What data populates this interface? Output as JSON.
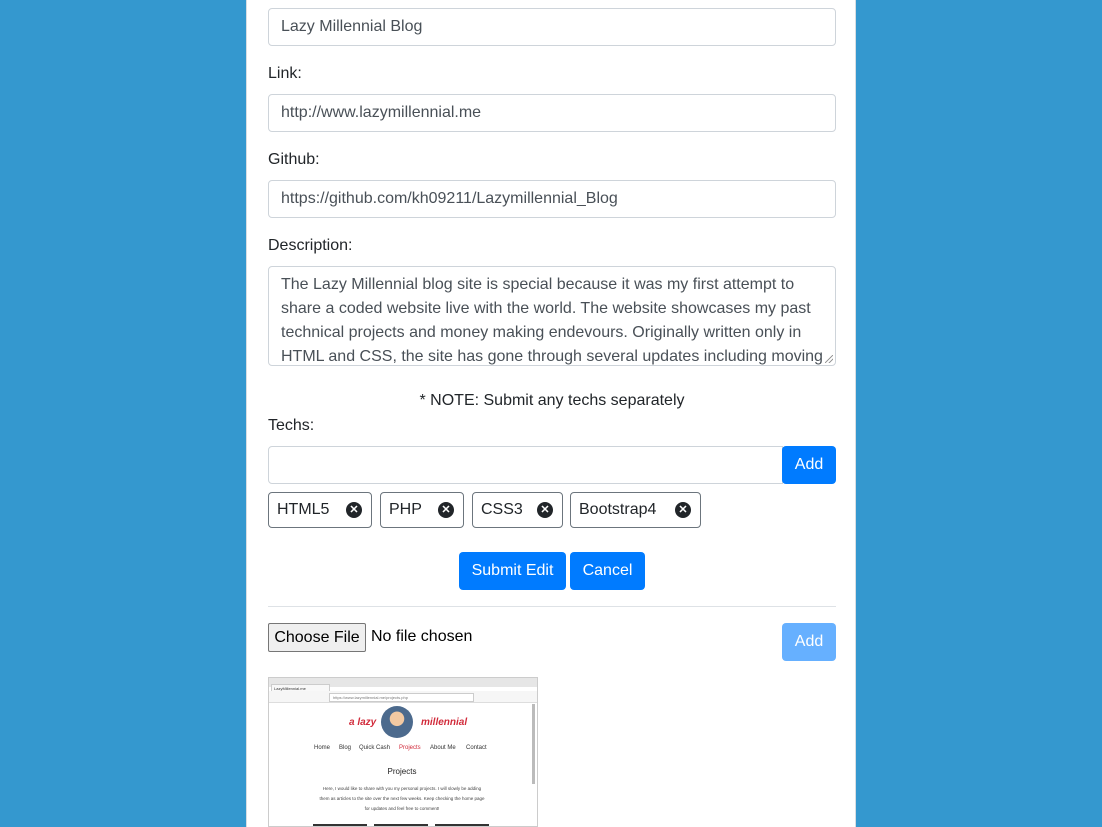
{
  "form": {
    "title_value": "Lazy Millennial Blog",
    "link_label": "Link:",
    "link_value": "http://www.lazymillennial.me",
    "github_label": "Github:",
    "github_value": "https://github.com/kh09211/Lazymillennial_Blog",
    "description_label": "Description:",
    "description_value": "The Lazy Millennial blog site is special because it was my first attempt to share a coded website live with the world. The website showcases my past technical projects and money making endevours. Originally written only in HTML and CSS, the site has gone through several updates including moving",
    "note": "* NOTE: Submit any techs separately",
    "techs_label": "Techs:",
    "techs_input_value": "",
    "add_tech_label": "Add",
    "techs": [
      {
        "label": "HTML5"
      },
      {
        "label": "PHP"
      },
      {
        "label": "CSS3"
      },
      {
        "label": "Bootstrap4"
      }
    ],
    "remove_glyph": "✕",
    "submit_label": "Submit Edit",
    "cancel_label": "Cancel"
  },
  "upload": {
    "choose_file_label": "Choose File",
    "file_status": "No file chosen",
    "add_label": "Add"
  },
  "thumbnail": {
    "tab_title": "LazyMillennial.me",
    "url": "https://www.lazymillennial.me/projects.php",
    "brand_left": "a lazy",
    "brand_right": "millennial",
    "nav": [
      "Home",
      "Blog",
      "Quick Cash",
      "Projects",
      "About Me",
      "Contact"
    ],
    "active_nav": "Projects",
    "heading": "Projects",
    "paragraph_lines": [
      "Here, I would like to share with you my personal projects. I will slowly be adding",
      "them as articles to the site over the next few weeks. Keep checking the home page",
      "for updates and feel free to comment!"
    ]
  },
  "colors": {
    "background": "#3498cf",
    "primary": "#007bff",
    "brand_red": "#d12a3a"
  }
}
